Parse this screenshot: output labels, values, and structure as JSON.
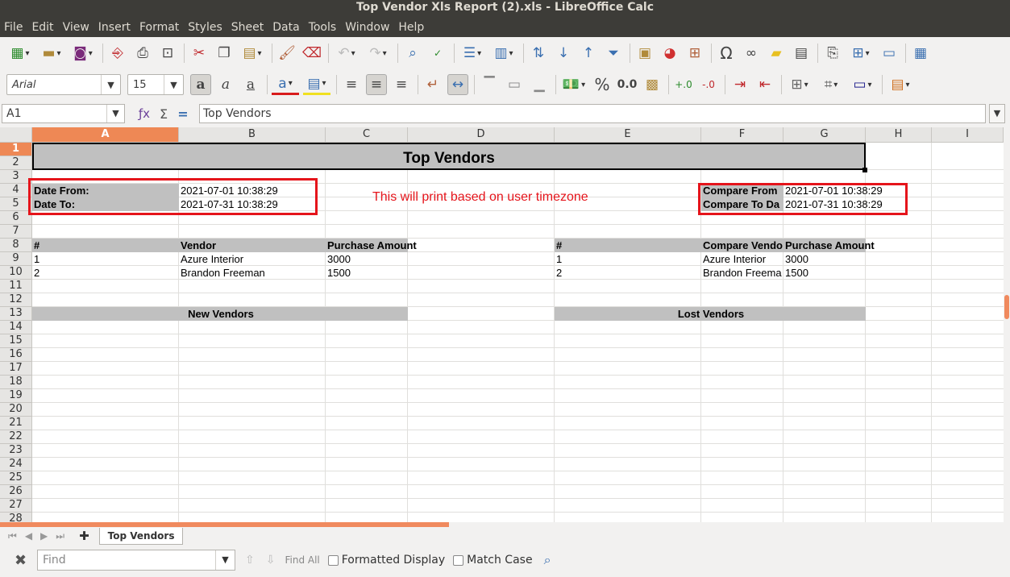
{
  "window": {
    "title": "Top Vendor Xls Report (2).xls - LibreOffice Calc"
  },
  "menu": [
    "File",
    "Edit",
    "View",
    "Insert",
    "Format",
    "Styles",
    "Sheet",
    "Data",
    "Tools",
    "Window",
    "Help"
  ],
  "toolbar": {
    "font_name": "Arial",
    "font_size": "15",
    "percent": "%",
    "decimal": "0.0"
  },
  "formula_bar": {
    "cell_ref": "A1",
    "content": "Top Vendors"
  },
  "sheet": {
    "columns": [
      "A",
      "B",
      "C",
      "D",
      "E",
      "F",
      "G",
      "H",
      "I"
    ],
    "rows": [
      "1",
      "2",
      "3",
      "4",
      "5",
      "6",
      "7",
      "8",
      "9",
      "10",
      "11",
      "12",
      "13",
      "14",
      "15",
      "16",
      "17",
      "18",
      "19",
      "20",
      "21",
      "22",
      "23",
      "24",
      "25",
      "26",
      "27",
      "28"
    ],
    "title": "Top Vendors",
    "date_from_label": "Date From:",
    "date_from_value": "2021-07-01 10:38:29",
    "date_to_label": "Date To:",
    "date_to_value": "2021-07-31 10:38:29",
    "note": "This will print based on user timezone",
    "compare_from_label": "Compare From",
    "compare_from_value": "2021-07-01 10:38:29",
    "compare_to_label": "Compare To Da",
    "compare_to_value": "2021-07-31 10:38:29",
    "left_headers": [
      "#",
      "Vendor",
      "Purchase Amount"
    ],
    "right_headers": [
      "#",
      "Compare Vendo",
      "Purchase Amount"
    ],
    "left_rows": [
      [
        "1",
        "Azure Interior",
        "3000"
      ],
      [
        "2",
        "Brandon Freeman",
        "1500"
      ]
    ],
    "right_rows": [
      [
        "1",
        "Azure Interior",
        "3000"
      ],
      [
        "2",
        "Brandon Freema",
        "1500"
      ]
    ],
    "new_vendors": "New Vendors",
    "lost_vendors": "Lost Vendors"
  },
  "tabs": {
    "active": "Top Vendors"
  },
  "find": {
    "placeholder": "Find",
    "find_all": "Find All",
    "formatted_display": "Formatted Display",
    "match_case": "Match Case"
  }
}
